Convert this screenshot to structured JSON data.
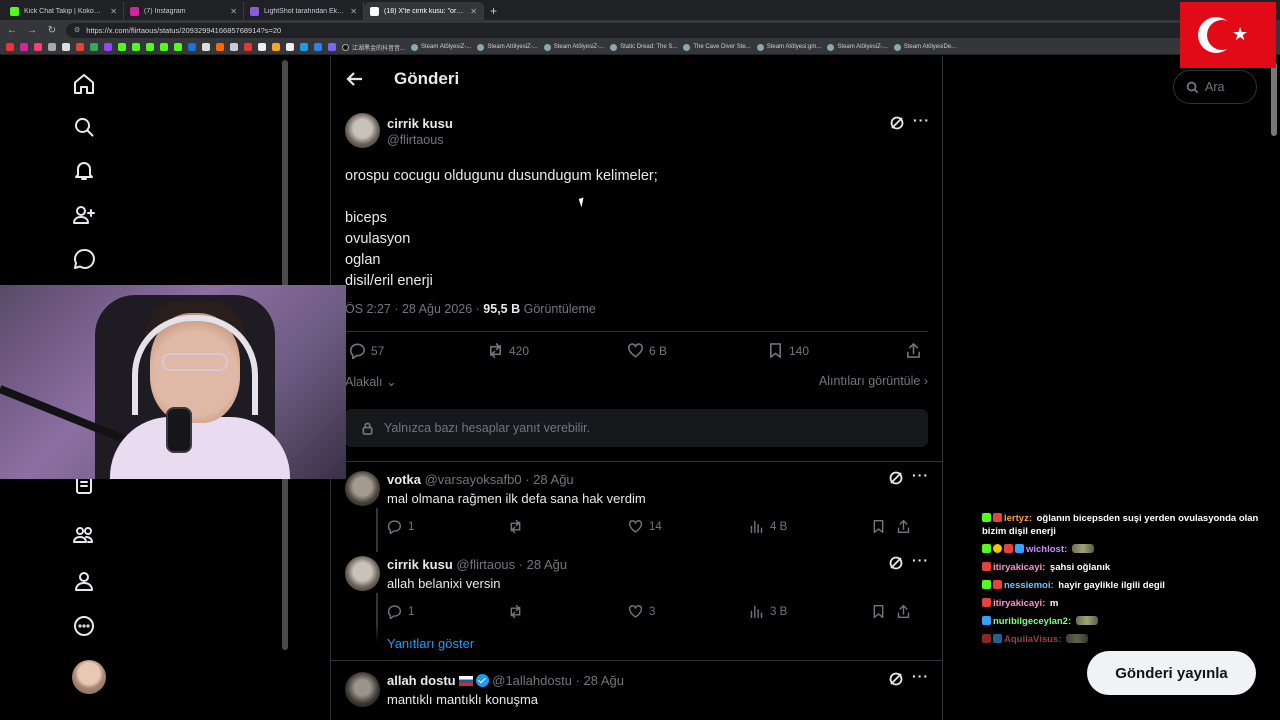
{
  "browser": {
    "tabs": [
      {
        "title": "Kick Chat Takip | KokoWich",
        "color": "#53fc18",
        "active": false
      },
      {
        "title": "(7) Instagram",
        "color": "#d6249f",
        "active": false
      },
      {
        "title": "LightShot tarafından Ekran Görüntü...",
        "color": "#8e5bd8",
        "active": false
      },
      {
        "title": "(18) X'te cirrik kusu: \"orospu cocu...",
        "color": "#ffffff",
        "active": true
      }
    ],
    "url": "https://x.com/flirtaous/status/2093299416685768914?s=20",
    "bookmarks": [
      "江湖黑金的抖音音...",
      "Steam AtölyesiZ-...",
      "Steam AtölyesiZ-...",
      "Steam AtölyesiZ-...",
      "Static Dread: The S...",
      "The Cave Diver Ste...",
      "Steam Atölyesi:gm...",
      "Steam AtölyesiZ-...",
      "Steam AtölyesiDe..."
    ]
  },
  "header": {
    "title": "Gönderi"
  },
  "post": {
    "name": "cirrik kusu",
    "handle": "@flirtaous",
    "text": "orospu cocugu oldugunu dusundugum kelimeler;\n\nbiceps\novulasyon\noglan\ndisil/eril enerji",
    "time": "ÖS 2:27 · 28 Ağu 2026 · ",
    "views": "95,5 B",
    "views_label": " Görüntüleme",
    "replies": "57",
    "reposts": "420",
    "likes": "6 B",
    "bookmarks": "140",
    "relevant_label": "Alakalı",
    "quotes_label": "Alıntıları görüntüle",
    "reply_limit": "Yalnızca bazı hesaplar yanıt verebilir."
  },
  "replies": [
    {
      "name": "votka",
      "handle": "@varsayoksafb0 · 28 Ağu",
      "text": "mal olmana rağmen ilk defa sana hak verdim",
      "replies": "1",
      "likes": "14",
      "views": "4 B"
    },
    {
      "name": "cirrik kusu",
      "handle": "@flirtaous · 28 Ağu",
      "text": "allah belanixi versin",
      "replies": "1",
      "likes": "3",
      "views": "3 B"
    },
    {
      "name": "allah dostu",
      "handle": "@1allahdostu · 28 Ağu",
      "text": "mantıklı mantıklı konuşma"
    }
  ],
  "show_replies": "Yanıtları göster",
  "search": {
    "placeholder": "Ara"
  },
  "post_button": "Gönderi yayınla",
  "chat": [
    {
      "user": "lertyz:",
      "msg": " oğlanın bicepsden suşi yerden ovulasyonda olan bizim dişil enerji",
      "color": "#ff9e3d"
    },
    {
      "user": "wichlost:",
      "msg": "",
      "color": "#c68cff"
    },
    {
      "user": "itiryakicayi:",
      "msg": " şahsi oğlanık",
      "color": "#ff8fd0"
    },
    {
      "user": "nessiemoi:",
      "msg": " hayir gaylikle ilgili degil",
      "color": "#6fc3ff"
    },
    {
      "user": "itiryakicayi:",
      "msg": " m",
      "color": "#ff8fd0"
    },
    {
      "user": "nuribilgeceylan2:",
      "msg": "",
      "color": "#7cff7c"
    },
    {
      "user": "AquilaVisus:",
      "msg": "",
      "color": "#ff6b6b"
    }
  ]
}
